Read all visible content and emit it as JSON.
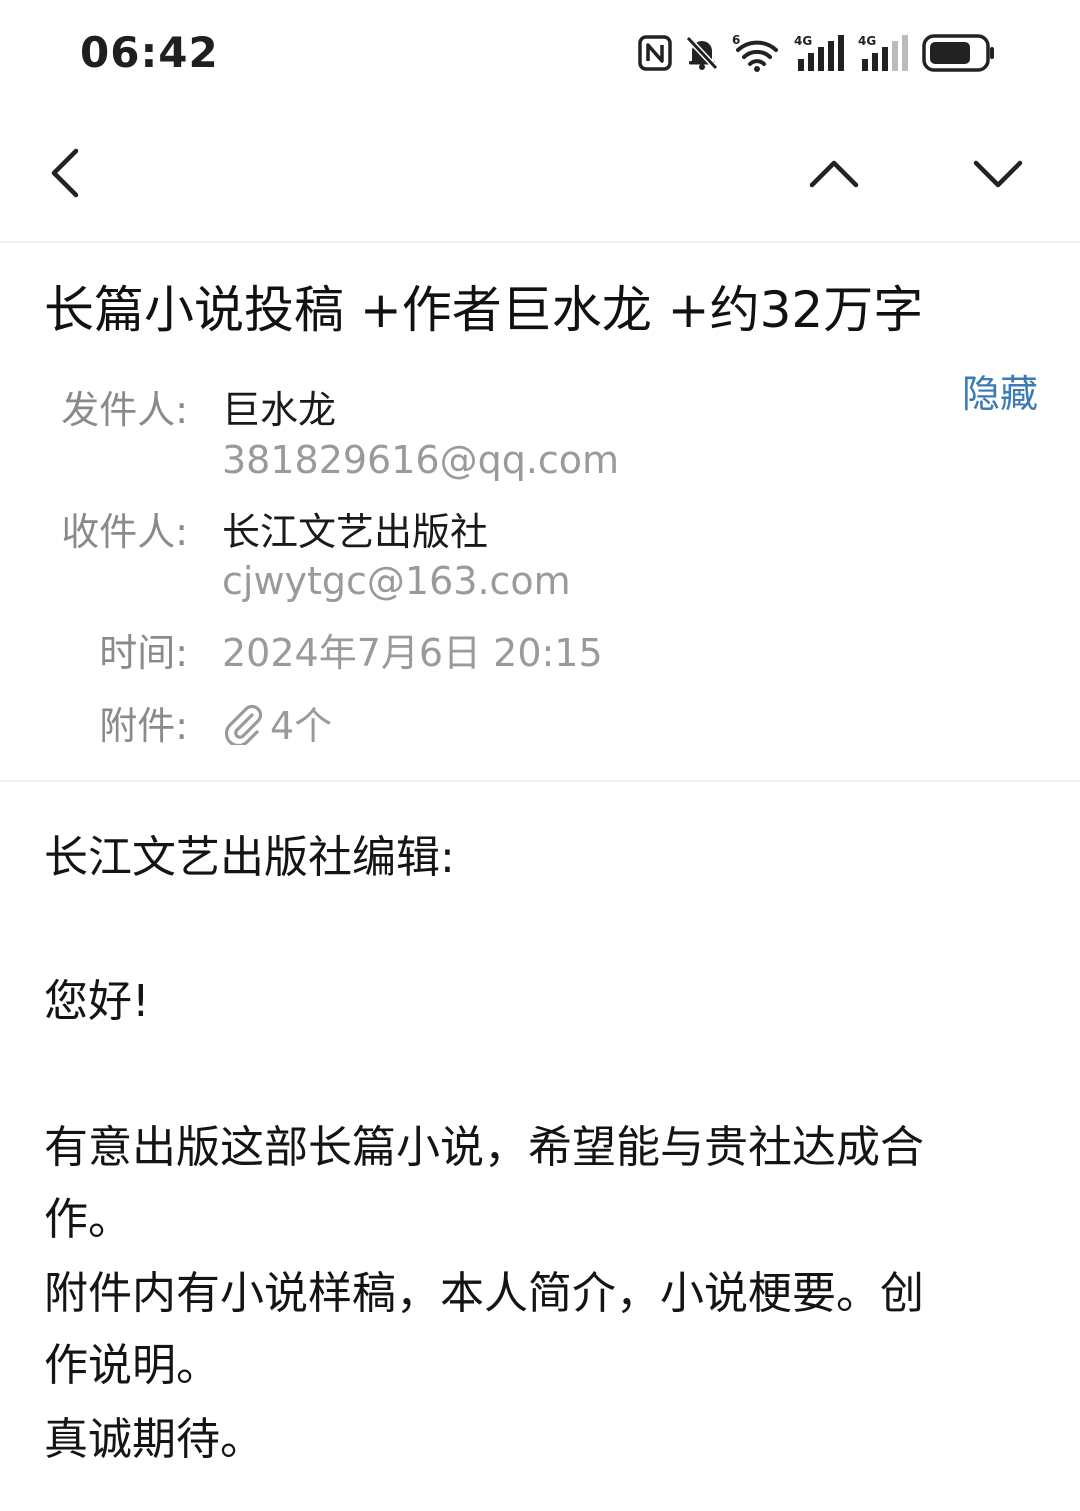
{
  "status_bar": {
    "time": "06:42",
    "icons": [
      "nfc-icon",
      "bell-muted-icon",
      "wifi-icon",
      "signal-4g-icon",
      "signal-4g-icon",
      "battery-icon"
    ],
    "wifi_badge": "6",
    "network_label": "4G"
  },
  "nav": {
    "back_icon": "chevron-left-icon",
    "prev_icon": "chevron-up-icon",
    "next_icon": "chevron-down-icon"
  },
  "email": {
    "subject": "长篇小说投稿 +作者巨水龙 +约32万字",
    "hide_label": "隐藏",
    "sender_label": "发件人:",
    "sender_name": "巨水龙",
    "sender_email": "381829616@qq.com",
    "recipient_label": "收件人:",
    "recipient_name": "长江文艺出版社",
    "recipient_email": "cjwytgc@163.com",
    "time_label": "时间:",
    "time_value": "2024年7月6日 20:15",
    "attachment_label": "附件:",
    "attachment_count": "4个"
  },
  "body": {
    "lines": [
      "长江文艺出版社编辑:",
      "您好!",
      "有意出版这部长篇小说，希望能与贵社达成合",
      "作。",
      "附件内有小说样稿，本人简介，小说梗要。创",
      "作说明。",
      "真诚期待。"
    ]
  },
  "colors": {
    "link": "#3b7ab4",
    "label_gray": "#8a8a8a",
    "text": "#1a1a1a"
  }
}
